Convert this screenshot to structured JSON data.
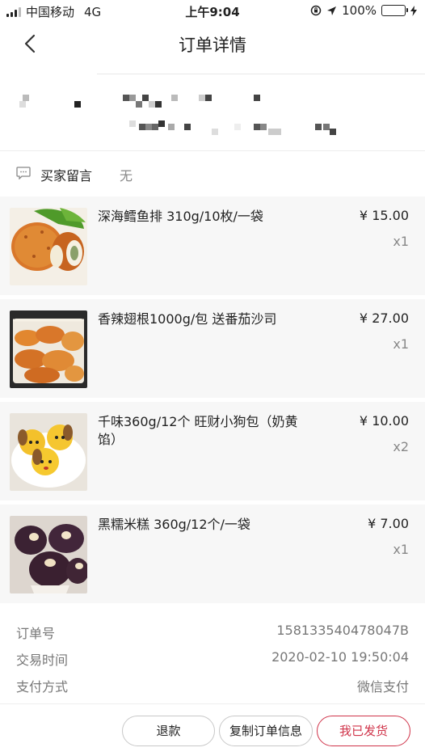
{
  "status_bar": {
    "carrier": "中国移动",
    "network": "4G",
    "time": "上午9:04",
    "battery": "100%"
  },
  "nav": {
    "title": "订单详情"
  },
  "buyer_message": {
    "label": "买家留言",
    "value": "无"
  },
  "products": [
    {
      "name": "深海鳕鱼排 310g/10枚/一袋",
      "price": "¥ 15.00",
      "qty": "x1"
    },
    {
      "name": "香辣翅根1000g/包 送番茄沙司",
      "price": "¥ 27.00",
      "qty": "x1"
    },
    {
      "name": "千味360g/12个 旺财小狗包（奶黄馅）",
      "price": "¥ 10.00",
      "qty": "x2"
    },
    {
      "name": "黑糯米糕 360g/12个/一袋",
      "price": "¥ 7.00",
      "qty": "x1"
    }
  ],
  "order_info": [
    {
      "label": "订单号",
      "value": "158133540478047B"
    },
    {
      "label": "交易时间",
      "value": "2020-02-10 19:50:04"
    },
    {
      "label": "支付方式",
      "value": "微信支付"
    }
  ],
  "actions": {
    "refund": "退款",
    "copy": "复制订单信息",
    "ship": "我已发货"
  },
  "colors": {
    "accent": "#d0344a",
    "battery": "#4cd964",
    "product_bg": "#f7f7f7"
  }
}
